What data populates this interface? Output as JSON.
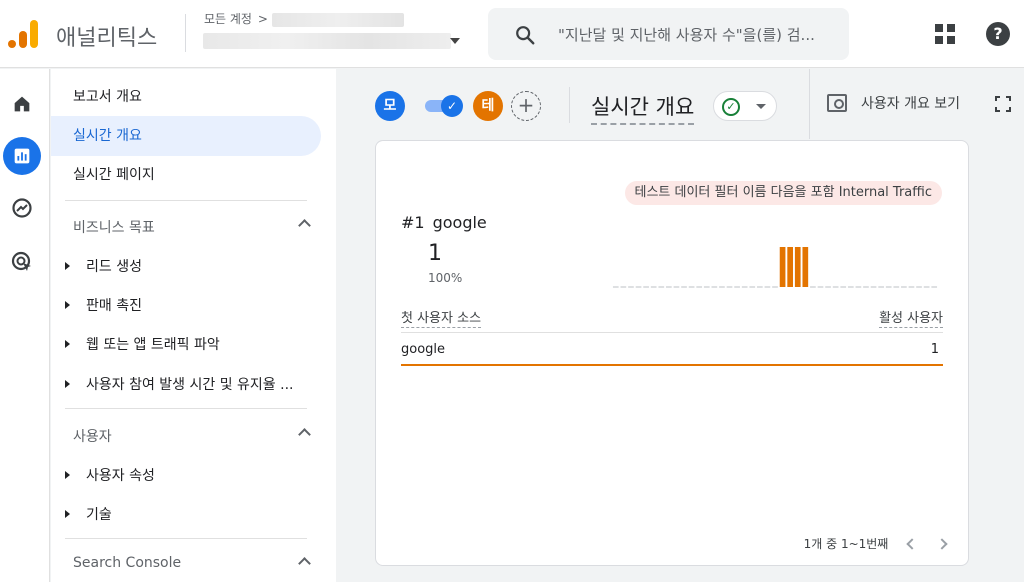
{
  "app": {
    "product_name": "애널리틱스"
  },
  "account": {
    "crumb_label": "모든 계정",
    "crumb_chevron": ">"
  },
  "search": {
    "placeholder": "\"지난달 및 지난해 사용자 수\"을(를) 검..."
  },
  "nav": {
    "items": [
      {
        "label": "보고서 개요"
      },
      {
        "label": "실시간 개요"
      },
      {
        "label": "실시간 페이지"
      }
    ],
    "sections": [
      {
        "title": "비즈니스 목표",
        "children": [
          "리드 생성",
          "판매 촉진",
          "웹 또는 앱 트래픽 파악",
          "사용자 참여 발생 시간 및 유지율 ..."
        ]
      },
      {
        "title": "사용자",
        "children": [
          "사용자 속성",
          "기술"
        ]
      },
      {
        "title": "Search Console",
        "children": []
      }
    ]
  },
  "header": {
    "comparisons": [
      {
        "letter": "모",
        "color": "#1a73e8"
      },
      {
        "letter": "테",
        "color": "#e37400"
      }
    ],
    "toggle_check": "✓",
    "add_symbol": "+",
    "title": "실시간 개요",
    "status_check": "✓",
    "snapshot_label": "사용자 개요 보기"
  },
  "card": {
    "filter_chip": "테스트 데이터 필터 이름 다음을 포함 Internal Traffic",
    "rank": "#1",
    "top_source": "google",
    "value": "1",
    "percent": "100%",
    "table": {
      "col_source": "첫 사용자 소스",
      "col_users": "활성 사용자",
      "rows": [
        {
          "source": "google",
          "users": "1"
        }
      ]
    },
    "pagination": "1개 중 1~1번째"
  },
  "chart_data": {
    "type": "bar",
    "values": [
      0,
      0,
      0,
      0,
      0,
      0,
      0,
      0,
      0,
      0,
      0,
      0,
      0,
      0,
      0,
      0,
      0,
      0,
      0,
      0,
      0,
      0,
      1,
      1,
      1,
      1,
      0,
      0,
      0,
      0,
      0,
      0,
      0,
      0,
      0,
      0,
      0,
      0,
      0,
      0,
      0,
      0,
      0
    ],
    "colors": {
      "bar": "#e37400",
      "baseline": "#bdc1c6"
    }
  }
}
